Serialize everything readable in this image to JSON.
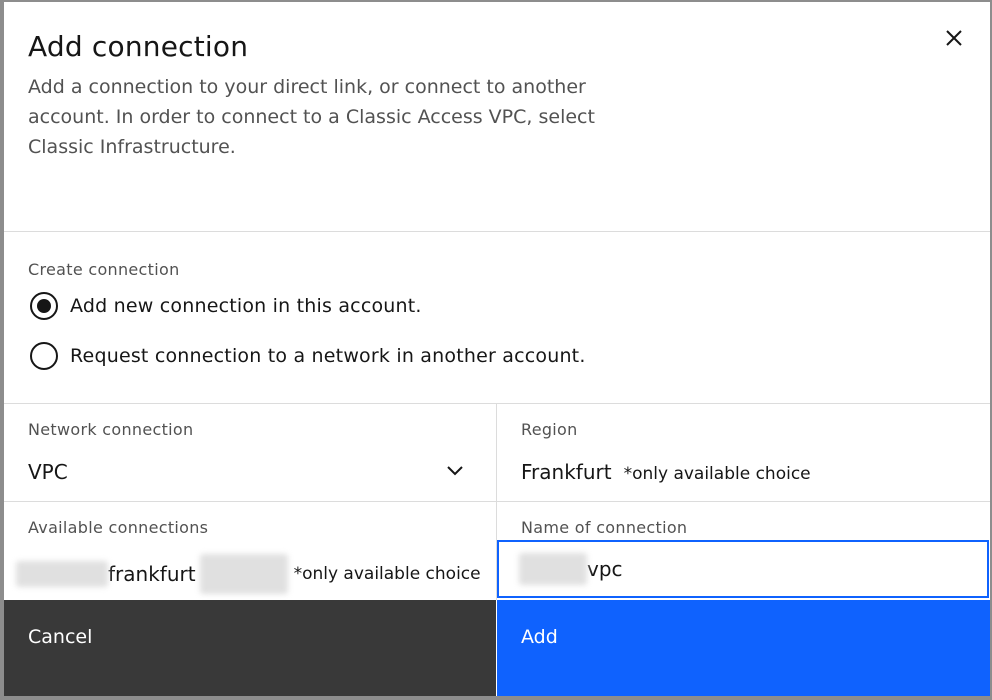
{
  "modal": {
    "title": "Add connection",
    "description": "Add a connection to your direct link, or connect to another account. In order to connect to a Classic Access VPC, select Classic Infrastructure.",
    "close_icon": "close-icon"
  },
  "create_connection": {
    "label": "Create connection",
    "options": [
      {
        "label": "Add new connection in this account.",
        "selected": true
      },
      {
        "label": "Request connection to a network in another account.",
        "selected": false
      }
    ]
  },
  "network_connection": {
    "label": "Network connection",
    "value": "VPC",
    "icon": "chevron-down-icon"
  },
  "region": {
    "label": "Region",
    "value": "Frankfurt",
    "note": "*only available choice"
  },
  "available_connections": {
    "label": "Available connections",
    "value_visible": "frankfurt",
    "note": "*only available choice"
  },
  "name_of_connection": {
    "label": "Name of connection",
    "value_visible": "vpc"
  },
  "footer": {
    "cancel_label": "Cancel",
    "add_label": "Add"
  },
  "colors": {
    "primary": "#0f62fe",
    "secondary": "#393939",
    "text": "#161616",
    "label": "#525252",
    "divider": "#dcdcdc"
  }
}
